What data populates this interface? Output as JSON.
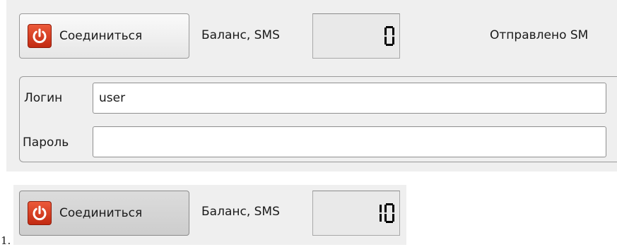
{
  "top_toolbar": {
    "connect_label": "Соединиться",
    "balance_label": "Баланс, SMS",
    "balance_value": "0",
    "sent_label": "Отправлено SM"
  },
  "login_form": {
    "login_label": "Логин",
    "login_value": "user",
    "password_label": "Пароль",
    "password_value": ""
  },
  "bottom_toolbar": {
    "caption": "1.",
    "connect_label": "Соединиться",
    "balance_label": "Баланс, SMS",
    "balance_value": "10"
  },
  "icons": {
    "connect_button_icon": "power-icon"
  },
  "colors": {
    "power_icon": "#d8391c",
    "background": "#efefef"
  }
}
